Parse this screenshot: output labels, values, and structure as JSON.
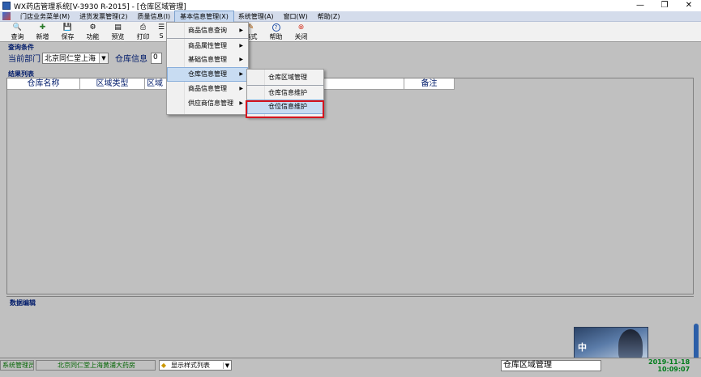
{
  "window": {
    "title": "WX药店管理系统[V-3930 R-2015] - [仓库区域管理]",
    "controls": [
      "—",
      "❐",
      "✕"
    ]
  },
  "menubar": {
    "items": [
      {
        "label": "门店业务菜单(M)"
      },
      {
        "label": "进货发票管理(2)"
      },
      {
        "label": "质量信息(I)"
      },
      {
        "label": "基本信息管理(X)"
      },
      {
        "label": "系统管理(A)"
      },
      {
        "label": "窗口(W)"
      },
      {
        "label": "帮助(Z)"
      }
    ]
  },
  "toolbar": {
    "buttons": [
      {
        "label": "查询",
        "icon": "binoculars-icon",
        "glyph": "🔍"
      },
      {
        "label": "新增",
        "icon": "new-icon",
        "glyph": "✚"
      },
      {
        "label": "保存",
        "icon": "save-icon",
        "glyph": "💾"
      },
      {
        "label": "功能",
        "icon": "function-icon",
        "glyph": "⚙"
      },
      {
        "label": "预览",
        "icon": "preview-icon",
        "glyph": "▤"
      },
      {
        "label": "打印",
        "icon": "print-icon",
        "glyph": "⎙"
      },
      {
        "label": "S",
        "icon": "settings-icon",
        "glyph": "☰"
      }
    ],
    "right_buttons": [
      {
        "label": "格式",
        "icon": "format-icon",
        "glyph": "✎"
      },
      {
        "label": "帮助",
        "icon": "help-icon",
        "glyph": "?"
      },
      {
        "label": "关闭",
        "icon": "close-icon",
        "glyph": "⊗"
      }
    ]
  },
  "query": {
    "section_title": "查询条件",
    "dept_label": "当前部门",
    "dept_value": "北京同仁堂上海",
    "warehouse_label": "仓库信息",
    "warehouse_value": "0"
  },
  "results": {
    "section_title": "结果列表",
    "columns": [
      "仓库名称",
      "区域类型",
      "区域",
      "",
      "",
      "备注"
    ]
  },
  "edit": {
    "section_title": "数据编辑"
  },
  "status": {
    "user": "系统管理员",
    "store": "北京同仁堂上海黄浦大药房",
    "style_list": "显示样式列表",
    "module": "仓库区域管理",
    "date": "2019-11-18",
    "time": "10:09:07",
    "mascot_text": "中"
  },
  "menu_basic_info": {
    "items": [
      {
        "label": "商品信息查询",
        "has_sub": true
      },
      {
        "label": "商品属性管理",
        "has_sub": true
      },
      {
        "label": "基础信息管理",
        "has_sub": true
      },
      {
        "label": "仓库信息管理",
        "has_sub": true
      },
      {
        "label": "商品信息管理",
        "has_sub": true
      },
      {
        "label": "供应商信息管理",
        "has_sub": true
      }
    ]
  },
  "menu_warehouse": {
    "items": [
      {
        "label": "仓库区域管理"
      },
      {
        "label": "仓库信息维护"
      },
      {
        "label": "仓位信息维护"
      }
    ]
  }
}
